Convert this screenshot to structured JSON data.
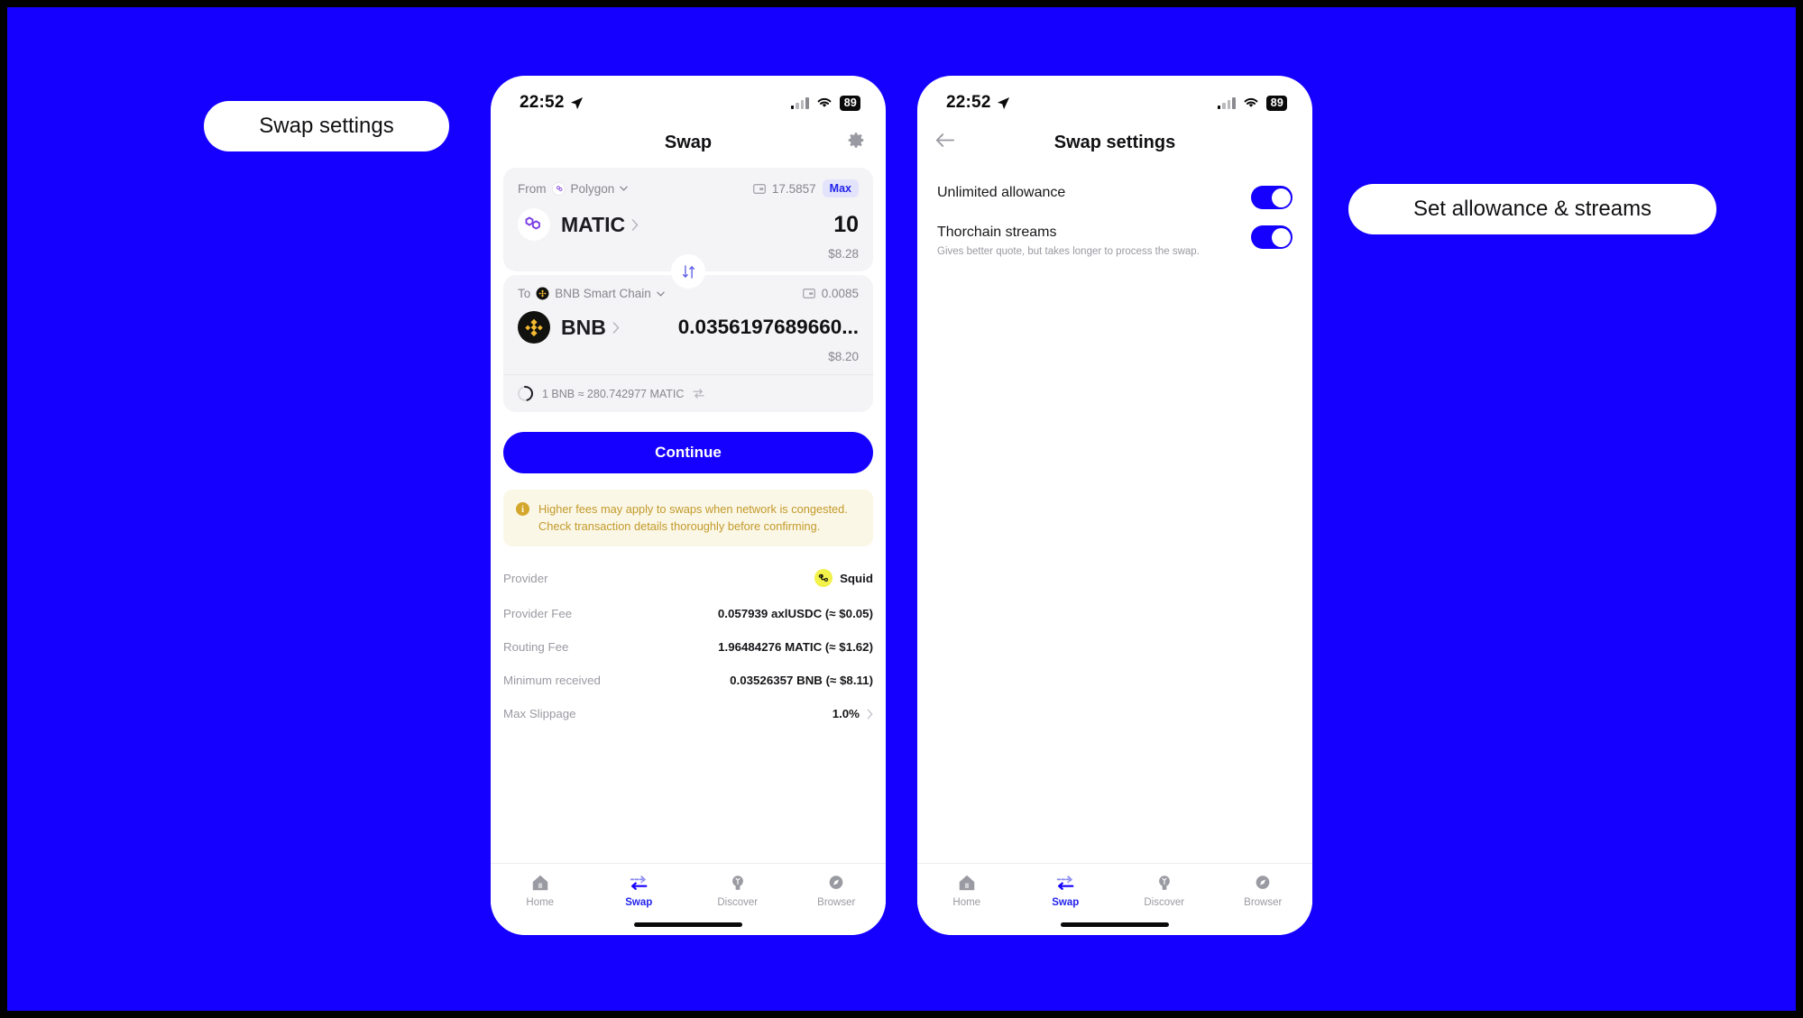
{
  "callouts": {
    "left": "Swap settings",
    "right": "Set allowance & streams"
  },
  "status_bar": {
    "time": "22:52",
    "battery": "89",
    "location_icon": "location-arrow-icon",
    "wifi_icon": "wifi-icon",
    "signal_icon": "cellular-signal-icon"
  },
  "swap_screen": {
    "title": "Swap",
    "gear_icon": "gear-icon",
    "from": {
      "label": "From",
      "chain": "Polygon",
      "chain_icon": "polygon-icon",
      "balance": "17.5857",
      "wallet_icon": "wallet-icon",
      "max_label": "Max",
      "token": "MATIC",
      "token_icon": "matic-token-icon",
      "amount": "10",
      "fiat": "$8.28"
    },
    "switch_icon": "swap-direction-icon",
    "to": {
      "label": "To",
      "chain": "BNB Smart Chain",
      "chain_icon": "bnb-chain-icon",
      "balance": "0.0085",
      "wallet_icon": "wallet-icon",
      "token": "BNB",
      "token_icon": "bnb-token-icon",
      "amount": "0.0356197689660...",
      "fiat": "$8.20"
    },
    "rate": "1 BNB ≈ 280.742977 MATIC",
    "rate_refresh_icon": "refresh-rate-icon",
    "continue_label": "Continue",
    "warning": "Higher fees may apply to swaps when network is congested. Check transaction details thoroughly before confirming.",
    "warning_icon": "info-icon",
    "details": [
      {
        "label": "Provider",
        "value": "Squid",
        "icon": "squid-logo-icon",
        "chevron": false
      },
      {
        "label": "Provider Fee",
        "value": "0.057939 axlUSDC (≈ $0.05)",
        "icon": "",
        "chevron": false
      },
      {
        "label": "Routing Fee",
        "value": "1.96484276 MATIC (≈ $1.62)",
        "icon": "",
        "chevron": false
      },
      {
        "label": "Minimum received",
        "value": "0.03526357 BNB (≈ $8.11)",
        "icon": "",
        "chevron": false
      },
      {
        "label": "Max Slippage",
        "value": "1.0%",
        "icon": "",
        "chevron": true
      }
    ]
  },
  "settings_screen": {
    "title": "Swap settings",
    "back_icon": "back-arrow-icon",
    "rows": [
      {
        "title": "Unlimited allowance",
        "subtitle": "",
        "toggle_on": true
      },
      {
        "title": "Thorchain streams",
        "subtitle": "Gives better quote, but takes longer to process the swap.",
        "toggle_on": true
      }
    ]
  },
  "tab_bar": {
    "tabs": [
      {
        "label": "Home",
        "icon": "home-icon",
        "active": false
      },
      {
        "label": "Swap",
        "icon": "swap-icon",
        "active": true
      },
      {
        "label": "Discover",
        "icon": "discover-icon",
        "active": false
      },
      {
        "label": "Browser",
        "icon": "browser-icon",
        "active": false
      }
    ]
  },
  "colors": {
    "background": "#1500FF",
    "accent": "#2222EE",
    "warning": "#C29A2B",
    "card": "#F4F4F6"
  }
}
